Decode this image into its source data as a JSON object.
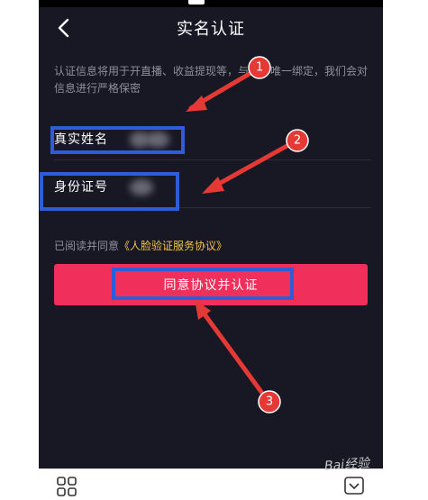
{
  "header": {
    "title": "实名认证"
  },
  "notice": {
    "text": "认证信息将用于开直播、收益提现等，与账号唯一绑定，我们会对信息进行严格保密"
  },
  "form": {
    "name_label": "真实姓名",
    "id_label": "身份证号"
  },
  "agreement": {
    "prefix": "已阅读并同意",
    "link_text": "《人脸验证服务协议》"
  },
  "submit": {
    "label": "同意协议并认证"
  },
  "annotations": {
    "markers": [
      "1",
      "2",
      "3"
    ],
    "marker_color": "#e53935",
    "highlight_color": "#2f5dd7"
  },
  "watermark": {
    "text": "Bai经验"
  },
  "icons": {
    "back": "chevron-left-icon",
    "grid": "grid-icon",
    "collapse": "chevron-down-box-icon"
  },
  "colors": {
    "background": "#171824",
    "accent": "#f0305a",
    "link": "#f0c24b"
  }
}
